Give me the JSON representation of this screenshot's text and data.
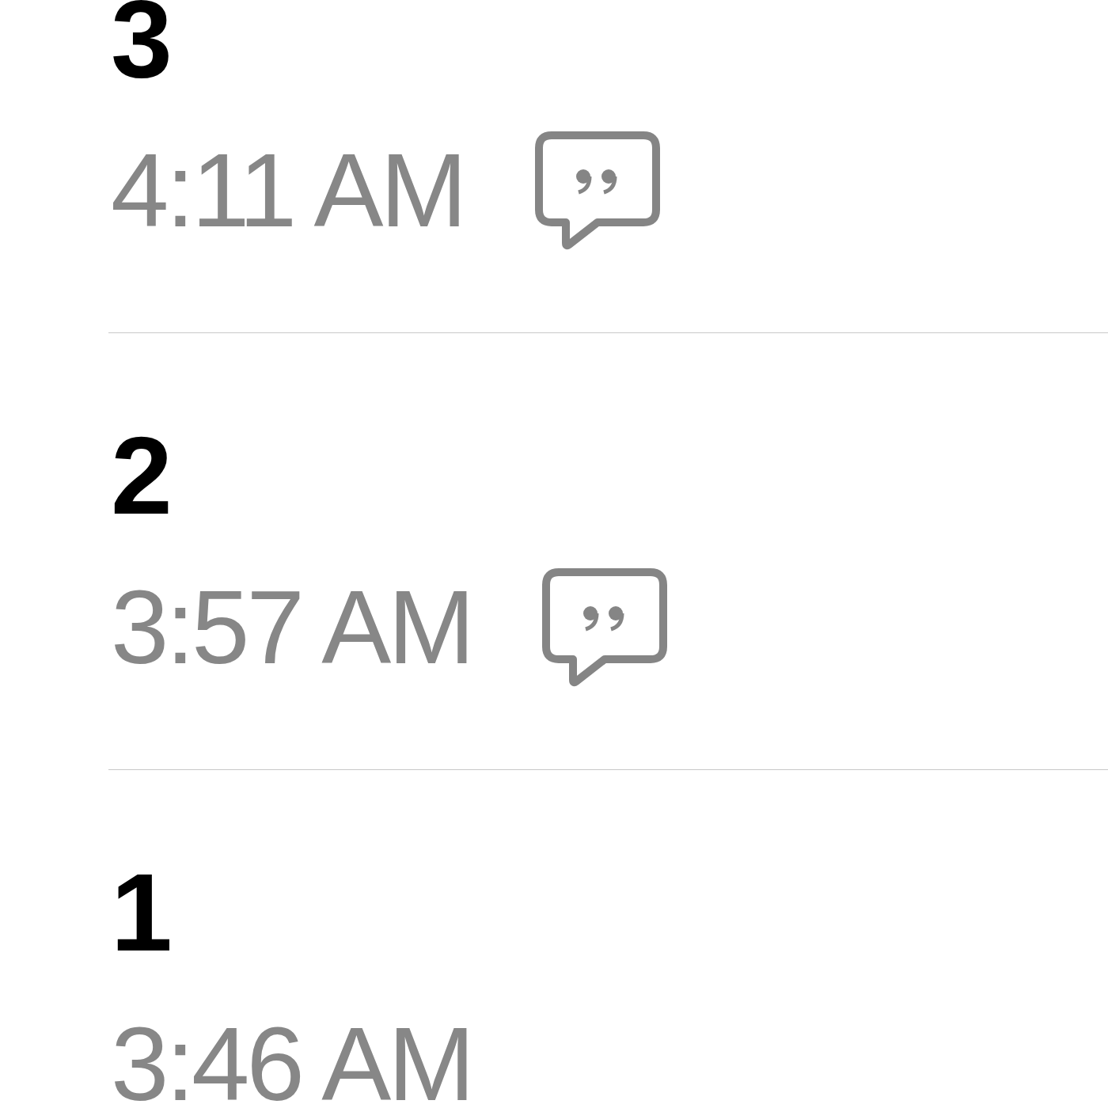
{
  "entries": [
    {
      "number": "3",
      "time": "4:11 AM",
      "has_note": true
    },
    {
      "number": "2",
      "time": "3:57 AM",
      "has_note": true
    },
    {
      "number": "1",
      "time": "3:46 AM",
      "has_note": false
    }
  ]
}
